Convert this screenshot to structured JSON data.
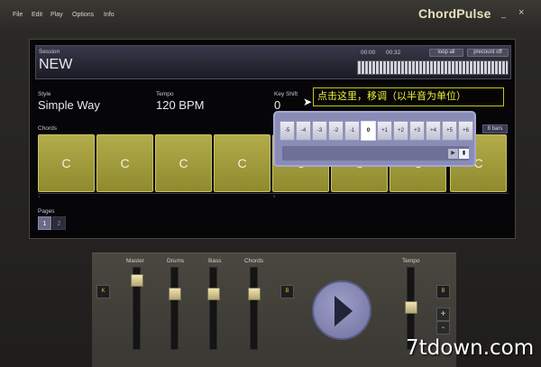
{
  "menubar": {
    "menus": [
      "File",
      "Edit",
      "Play",
      "Options",
      "Info"
    ],
    "app_title": "ChordPulse",
    "minimize": "_",
    "close": "×"
  },
  "session": {
    "label": "Session",
    "name": "NEW",
    "time_current": "00:00",
    "time_total": "00:32",
    "loop_label": "loop all",
    "precount_label": "precount off"
  },
  "style": {
    "label": "Style",
    "value": "Simple Way"
  },
  "tempo": {
    "label": "Tempo",
    "value": "120 BPM"
  },
  "key_shift": {
    "label": "Key Shift",
    "value": "0",
    "options": [
      "-5",
      "-4",
      "-3",
      "-2",
      "-1",
      "0",
      "+1",
      "+2",
      "+3",
      "+4",
      "+5",
      "+6"
    ],
    "selected": "0",
    "arrow": "▶",
    "ok": "▮"
  },
  "chords": {
    "label": "Chords",
    "bars_label": "8 bars",
    "items": [
      "C",
      "C",
      "C",
      "C",
      "C",
      "C",
      "C",
      "C"
    ],
    "ruler_ticks": [
      "1",
      "5"
    ]
  },
  "pages": {
    "label": "Pages",
    "items": [
      "1",
      "2"
    ],
    "active": "1"
  },
  "tooltip": {
    "text": "点击这里，移调（以半音为单位）"
  },
  "mixer": {
    "channels": [
      {
        "label": "Master",
        "level": 0.92
      },
      {
        "label": "Drums",
        "level": 0.72
      },
      {
        "label": "Bass",
        "level": 0.72
      },
      {
        "label": "Chords",
        "level": 0.72
      }
    ],
    "tempo": {
      "label": "Tempo",
      "level": 0.52
    },
    "side_buttons": [
      "K",
      "B",
      "B"
    ],
    "plus": "+",
    "minus": "-"
  },
  "watermark": "7tdown.com",
  "colors": {
    "chord_block": "#a8a23e",
    "tooltip_text": "#f0f03a",
    "play_button": "#8c8db8",
    "popup": "#8a8cb8"
  }
}
